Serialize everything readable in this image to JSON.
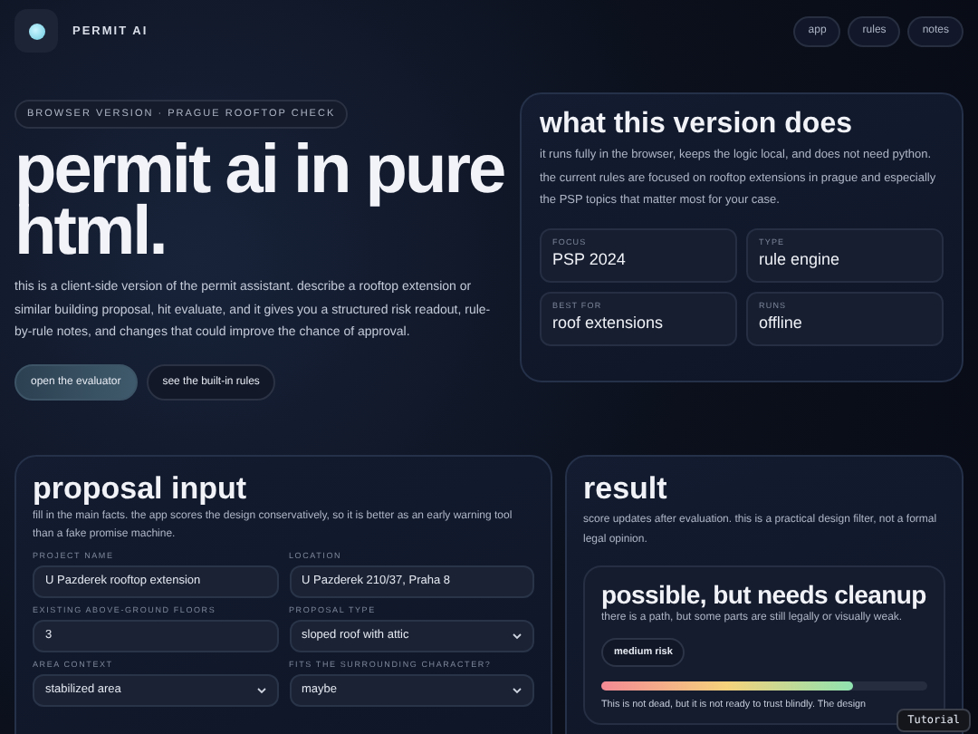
{
  "brand": {
    "name": "PERMIT AI"
  },
  "nav": [
    {
      "label": "app"
    },
    {
      "label": "rules"
    },
    {
      "label": "notes"
    }
  ],
  "hero": {
    "badge": "BROWSER VERSION · PRAGUE ROOFTOP CHECK",
    "title": "permit ai in pure html.",
    "intro": "this is a client-side version of the permit assistant. describe a rooftop extension or similar building proposal, hit evaluate, and it gives you a structured risk readout, rule-by-rule notes, and changes that could improve the chance of approval.",
    "buttons": [
      {
        "label": "open the evaluator",
        "kind": "primary"
      },
      {
        "label": "see the built-in rules",
        "kind": "secondary"
      }
    ]
  },
  "about": {
    "title": "what this version does",
    "text": "it runs fully in the browser, keeps the logic local, and does not need python. the current rules are focused on rooftop extensions in prague and especially the PSP topics that matter most for your case.",
    "facts": [
      {
        "label": "FOCUS",
        "value": "PSP 2024"
      },
      {
        "label": "TYPE",
        "value": "rule engine"
      },
      {
        "label": "BEST FOR",
        "value": "roof extensions"
      },
      {
        "label": "RUNS",
        "value": "offline"
      }
    ]
  },
  "proposal": {
    "title": "proposal input",
    "text": "fill in the main facts. the app scores the design conservatively, so it is better as an early warning tool than a fake promise machine.",
    "fields": [
      {
        "label": "PROJECT NAME",
        "kind": "text",
        "value": "U Pazderek rooftop extension"
      },
      {
        "label": "LOCATION",
        "kind": "text",
        "value": "U Pazderek 210/37, Praha 8"
      },
      {
        "label": "EXISTING ABOVE-GROUND FLOORS",
        "kind": "text",
        "value": "3"
      },
      {
        "label": "PROPOSAL TYPE",
        "kind": "select",
        "value": "sloped roof with attic"
      },
      {
        "label": "AREA CONTEXT",
        "kind": "select",
        "value": "stabilized area"
      },
      {
        "label": "FITS THE SURROUNDING CHARACTER?",
        "kind": "select",
        "value": "maybe"
      }
    ]
  },
  "result": {
    "title": "result",
    "text": "score updates after evaluation. this is a practical design filter, not a formal legal opinion.",
    "verdict": {
      "title": "possible, but needs cleanup",
      "text": "there is a path, but some parts are still legally or visually weak.",
      "risk": "medium risk",
      "level": 0.77,
      "note": "This is not dead, but it is not ready to trust blindly. The design"
    }
  },
  "tutorial": {
    "label": "Tutorial"
  }
}
